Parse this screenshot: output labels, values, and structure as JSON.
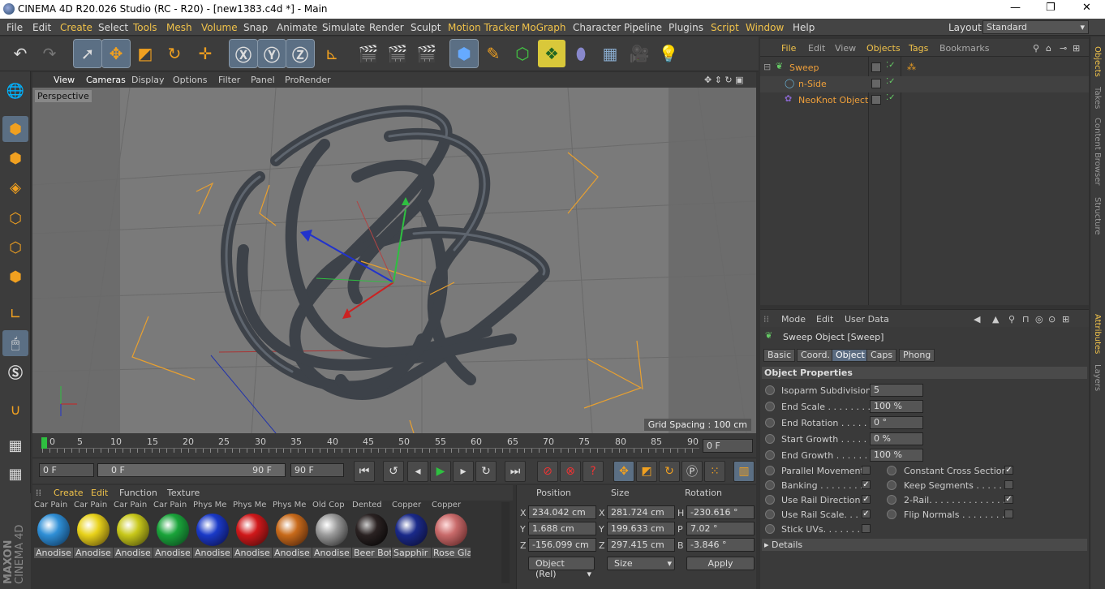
{
  "title_bar": {
    "title": "CINEMA 4D R20.026 Studio (RC - R20) - [new1383.c4d *] - Main"
  },
  "menu": {
    "items": [
      "File",
      "Edit",
      "Create",
      "Select",
      "Tools",
      "Mesh",
      "Volume",
      "Snap",
      "Animate",
      "Simulate",
      "Render",
      "Sculpt",
      "Motion Tracker",
      "MoGraph",
      "Character",
      "Pipeline",
      "Plugins",
      "Script",
      "Window",
      "Help"
    ],
    "layout_label": "Layout:",
    "layout_value": "Standard"
  },
  "viewport": {
    "menu": [
      "View",
      "Cameras",
      "Display",
      "Options",
      "Filter",
      "Panel",
      "ProRender"
    ],
    "camera_label": "Perspective",
    "grid_spacing": "Grid Spacing : 100 cm"
  },
  "timeline": {
    "ticks": [
      "0",
      "5",
      "10",
      "15",
      "20",
      "25",
      "30",
      "35",
      "40",
      "45",
      "50",
      "55",
      "60",
      "65",
      "70",
      "75",
      "80",
      "85",
      "90"
    ],
    "end_field": "0 F",
    "current_frame": "0 F",
    "range_start": "0 F",
    "range_end": "90 F",
    "max_frame": "90 F"
  },
  "materials": {
    "menu": [
      "Create",
      "Edit",
      "Function",
      "Texture"
    ],
    "items": [
      {
        "header": "Car Pain",
        "name": "Anodise",
        "color": "#2f8fd6"
      },
      {
        "header": "Car Pain",
        "name": "Anodise",
        "color": "#e8d21a"
      },
      {
        "header": "Car Pain",
        "name": "Anodise",
        "color": "#c8c81a"
      },
      {
        "header": "Car Pain",
        "name": "Anodise",
        "color": "#1aa43a"
      },
      {
        "header": "Phys Me",
        "name": "Anodise",
        "color": "#1a3ac8"
      },
      {
        "header": "Phys Me",
        "name": "Anodise",
        "color": "#d0181a"
      },
      {
        "header": "Phys Me",
        "name": "Anodise",
        "color": "#c86a1a"
      },
      {
        "header": "Old Cop",
        "name": "Anodise",
        "color": "#9a9a9a"
      },
      {
        "header": "Dented",
        "name": "Beer Bot",
        "color": "#2a2222"
      },
      {
        "header": "Copper",
        "name": "Sapphir",
        "color": "#1a2a8a"
      },
      {
        "header": "Copper",
        "name": "Rose Gla",
        "color": "#c86a6a"
      }
    ]
  },
  "coords": {
    "headers": [
      "Position",
      "Size",
      "Rotation"
    ],
    "rows": [
      {
        "axis": "X",
        "pos": "234.042 cm",
        "saxis": "X",
        "size": "281.724 cm",
        "raxis": "H",
        "rot": "-230.616 °"
      },
      {
        "axis": "Y",
        "pos": "1.688 cm",
        "saxis": "Y",
        "size": "199.633 cm",
        "raxis": "P",
        "rot": "7.02 °"
      },
      {
        "axis": "Z",
        "pos": "-156.099 cm",
        "saxis": "Z",
        "size": "297.415 cm",
        "raxis": "B",
        "rot": "-3.846 °"
      }
    ],
    "mode": "Object (Rel)",
    "size_mode": "Size",
    "apply": "Apply"
  },
  "objects": {
    "menu": [
      "File",
      "Edit",
      "View",
      "Objects",
      "Tags",
      "Bookmarks"
    ],
    "items": [
      {
        "name": "Sweep"
      },
      {
        "name": "n-Side"
      },
      {
        "name": "NeoKnot Object"
      }
    ]
  },
  "right_tabs": [
    "Objects",
    "Takes",
    "Content Browser",
    "Structure",
    "Attributes",
    "Layers"
  ],
  "attributes": {
    "menu": [
      "Mode",
      "Edit",
      "User Data"
    ],
    "object_title": "Sweep Object [Sweep]",
    "tabs": [
      "Basic",
      "Coord.",
      "Object",
      "Caps",
      "Phong"
    ],
    "section": "Object Properties",
    "fields": [
      {
        "label": "Isoparm Subdivision",
        "value": "5"
      },
      {
        "label": "End Scale . . . . . . . . . .",
        "value": "100 %"
      },
      {
        "label": "End Rotation . . . . . .",
        "value": "0 °"
      },
      {
        "label": "Start Growth . . . . . .",
        "value": "0 %"
      },
      {
        "label": "End Growth . . . . . . .",
        "value": "100 %"
      }
    ],
    "checks_left": [
      {
        "label": "Parallel Movement",
        "checked": false
      },
      {
        "label": "Banking . . . . . . . . .",
        "checked": true
      },
      {
        "label": "Use Rail Direction",
        "checked": true
      },
      {
        "label": "Use Rail Scale. . . .",
        "checked": true
      },
      {
        "label": "Stick UVs. . . . . . . .",
        "checked": false
      }
    ],
    "checks_right": [
      {
        "label": "Constant Cross Section",
        "checked": true
      },
      {
        "label": "Keep Segments . . . . . . .",
        "checked": false
      },
      {
        "label": "2-Rail. . . . . . . . . . . . . . .",
        "checked": true
      },
      {
        "label": "Flip Normals . . . . . . . . .",
        "checked": false
      }
    ],
    "details": "Details"
  },
  "logo": {
    "line1": "MAXON",
    "line2": "CINEMA 4D"
  }
}
